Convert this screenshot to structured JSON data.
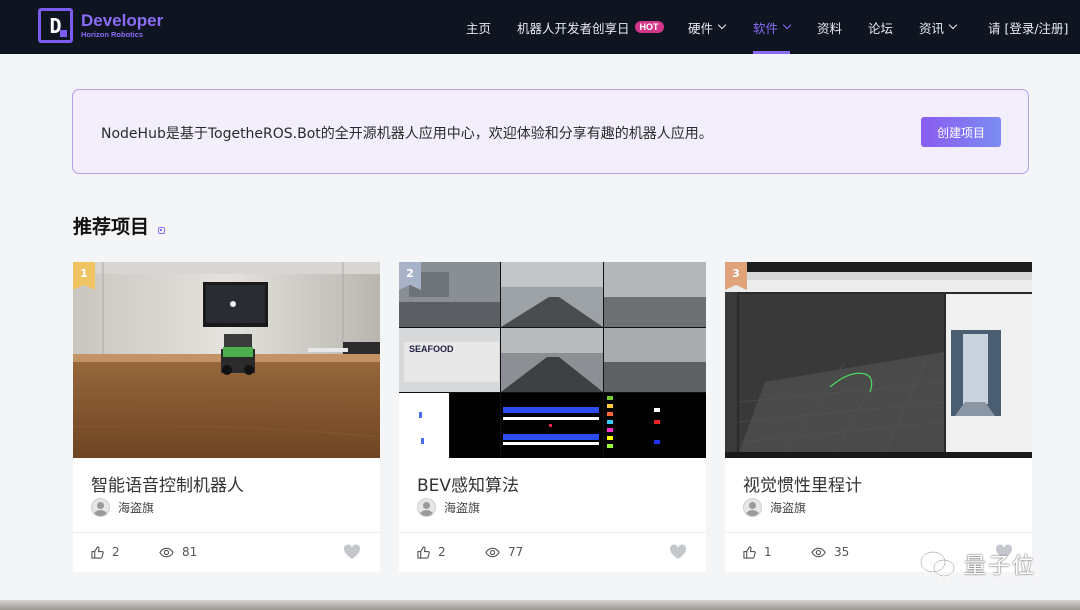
{
  "header": {
    "logo_letter": "D",
    "brand_title": "Developer",
    "brand_sub": "Horizon Robotics",
    "nav": [
      {
        "label": "主页"
      },
      {
        "label": "机器人开发者创享日",
        "badge": "HOT"
      },
      {
        "label": "硬件",
        "dropdown": true
      },
      {
        "label": "软件",
        "dropdown": true,
        "active": true
      },
      {
        "label": "资料"
      },
      {
        "label": "论坛"
      },
      {
        "label": "资讯",
        "dropdown": true
      }
    ],
    "login_label": "请 [登录/注册]"
  },
  "banner": {
    "text": "NodeHub是基于TogetheROS.Bot的全开源机器人应用中心，欢迎体验和分享有趣的机器人应用。",
    "create_label": "创建项目"
  },
  "section": {
    "title": "推荐项目"
  },
  "cards": [
    {
      "rank": "1",
      "title": "智能语音控制机器人",
      "author": "海盗旗",
      "likes": "2",
      "views": "81"
    },
    {
      "rank": "2",
      "title": "BEV感知算法",
      "author": "海盗旗",
      "likes": "2",
      "views": "77"
    },
    {
      "rank": "3",
      "title": "视觉惯性里程计",
      "author": "海盗旗",
      "likes": "1",
      "views": "35"
    }
  ],
  "watermark": {
    "text": "量子位"
  },
  "colors": {
    "accent": "#8a6cf7",
    "header_bg": "#0e1420",
    "hot": "#d4378a"
  }
}
